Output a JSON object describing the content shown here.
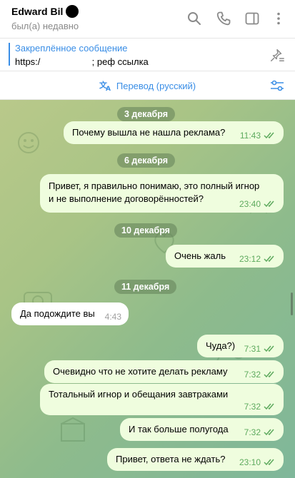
{
  "header": {
    "contact_name": "Edward Bil",
    "status": "был(а) недавно",
    "icons": [
      "search-icon",
      "phone-icon",
      "sidebar-icon",
      "more-icon"
    ]
  },
  "pinned": {
    "title": "Закреплённое сообщение",
    "text": "https:/                    ; реф ссылка"
  },
  "translate": {
    "label": "Перевод (русский)"
  },
  "colors": {
    "accent": "#3a8ee6",
    "outgoing_bubble": "#effdde",
    "incoming_bubble": "#ffffff",
    "read_check": "#5eaa5e"
  },
  "chat": {
    "dates": [
      "3 декабря",
      "6 декабря",
      "10 декабря",
      "11 декабря"
    ],
    "messages": [
      {
        "text": "Почему вышла не нашла реклама?",
        "time": "11:43",
        "direction": "out",
        "read": true
      },
      {
        "text": "Привет, я правильно понимаю, это полный игнор\nи не выполнение договорённостей?",
        "time": "23:40",
        "direction": "out",
        "read": true
      },
      {
        "text": "Очень жаль",
        "time": "23:12",
        "direction": "out",
        "read": true
      },
      {
        "text": "Да подождите вы",
        "time": "4:43",
        "direction": "in",
        "read": false
      },
      {
        "text": "Чуда?)",
        "time": "7:31",
        "direction": "out",
        "read": true
      },
      {
        "text": "Очевидно что не хотите делать рекламу",
        "time": "7:32",
        "direction": "out",
        "read": true
      },
      {
        "text": "Тотальный игнор и обещания завтраками",
        "time": "7:32",
        "direction": "out",
        "read": true
      },
      {
        "text": "И так больше полугода",
        "time": "7:32",
        "direction": "out",
        "read": true
      },
      {
        "text": "Привет, ответа не ждать?",
        "time": "23:10",
        "direction": "out",
        "read": true
      }
    ]
  }
}
